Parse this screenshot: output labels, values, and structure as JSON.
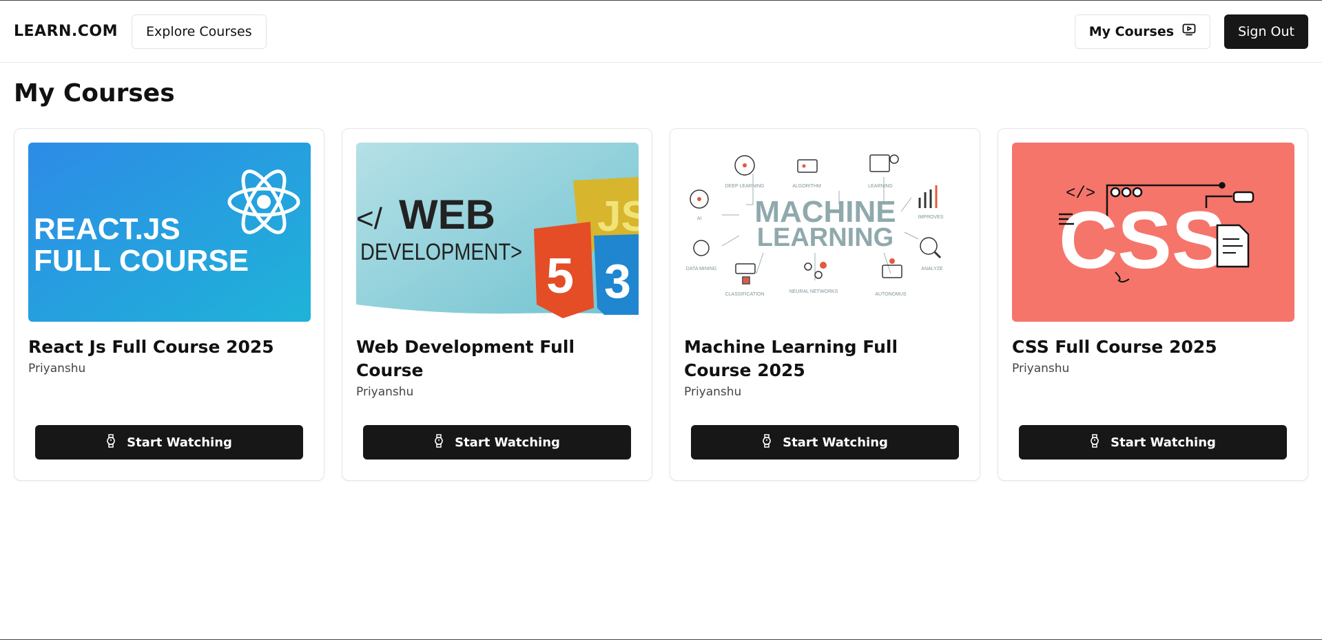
{
  "header": {
    "logo": "LEARN.COM",
    "explore_label": "Explore Courses",
    "my_courses_label": "My Courses",
    "sign_out_label": "Sign Out"
  },
  "page": {
    "title": "My Courses"
  },
  "courses": [
    {
      "title": "React Js Full Course 2025",
      "author": "Priyanshu",
      "button": "Start Watching",
      "thumb_text": [
        "REACT.JS",
        "FULL COURSE"
      ],
      "accent": "#2b8fe3"
    },
    {
      "title": "Web Development Full Course",
      "author": "Priyanshu",
      "button": "Start Watching",
      "thumb_text": [
        "</",
        "WEB",
        "DEVELOPMENT>",
        "5",
        "JS",
        "3"
      ],
      "accent": "#7fcbd6"
    },
    {
      "title": "Machine Learning Full Course 2025",
      "author": "Priyanshu",
      "button": "Start Watching",
      "thumb_text": [
        "MACHINE",
        "LEARNING",
        "DEEP LEARNING",
        "ALGORITHM",
        "LEARNING",
        "AI",
        "IMPROVES",
        "DATA MINING",
        "ANALYZE",
        "CLASSIFICATION",
        "NEURAL NETWORKS",
        "AUTONOMUS"
      ],
      "accent": "#8fa9ad"
    },
    {
      "title": "CSS Full Course 2025",
      "author": "Priyanshu",
      "button": "Start Watching",
      "thumb_text": [
        "</>",
        "CSS"
      ],
      "accent": "#f5756b"
    }
  ]
}
